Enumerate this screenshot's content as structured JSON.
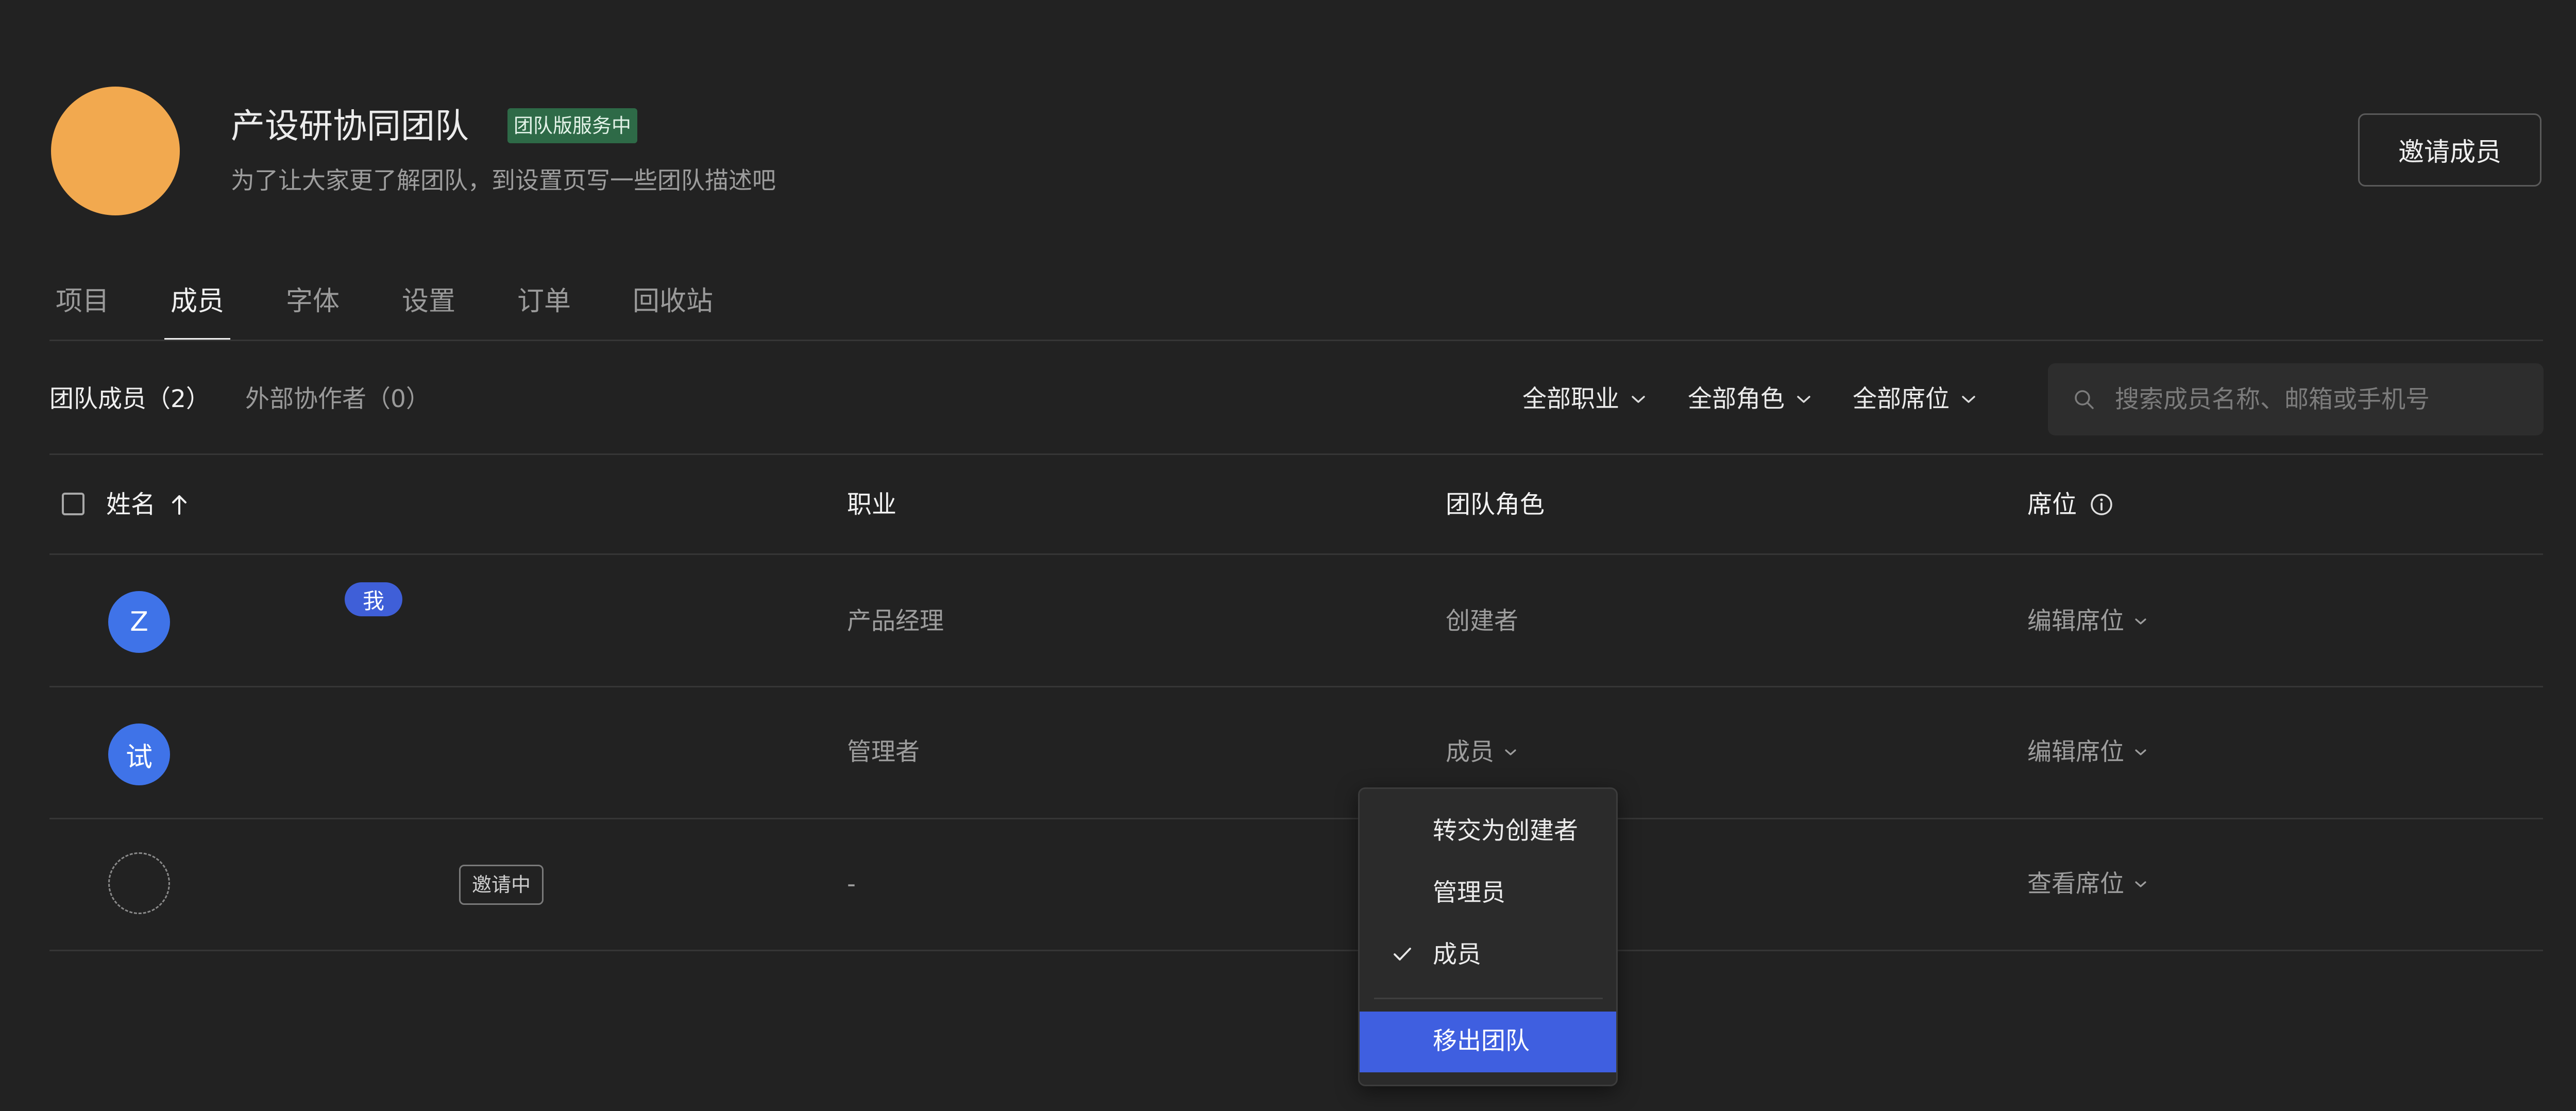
{
  "team": {
    "name": "产设研协同团队",
    "badge": "团队版服务中",
    "description": "为了让大家更了解团队，到设置页写一些团队描述吧",
    "avatar_color": "#f2a94f",
    "invite_button": "邀请成员"
  },
  "tabs": [
    {
      "label": "项目",
      "active": false
    },
    {
      "label": "成员",
      "active": true
    },
    {
      "label": "字体",
      "active": false
    },
    {
      "label": "设置",
      "active": false
    },
    {
      "label": "订单",
      "active": false
    },
    {
      "label": "回收站",
      "active": false
    }
  ],
  "member_tabs": {
    "team_members": "团队成员（2）",
    "external": "外部协作者（0）"
  },
  "filters": {
    "job": "全部职业",
    "role": "全部角色",
    "seat": "全部席位"
  },
  "search": {
    "placeholder": "搜索成员名称、邮箱或手机号",
    "value": ""
  },
  "table": {
    "headers": {
      "name": "姓名",
      "job": "职业",
      "role": "团队角色",
      "seat": "席位"
    },
    "sort": "ascending",
    "rows": [
      {
        "avatar": "Z",
        "badge": "我",
        "job": "产品经理",
        "role": "创建者",
        "role_editable": false,
        "seat": "编辑席位"
      },
      {
        "avatar": "试",
        "badge": "",
        "job": "管理者",
        "role": "成员",
        "role_editable": true,
        "seat": "编辑席位"
      },
      {
        "avatar": "",
        "badge": "邀请中",
        "job": "-",
        "role": "",
        "role_editable": false,
        "seat": "查看席位"
      }
    ]
  },
  "role_menu": {
    "items": [
      {
        "label": "转交为创建者",
        "checked": false
      },
      {
        "label": "管理员",
        "checked": false
      },
      {
        "label": "成员",
        "checked": true
      }
    ],
    "remove": "移出团队"
  },
  "colors": {
    "background": "#222222",
    "accent": "#3f5fe0",
    "avatar_blue": "#3f73e8",
    "badge_green": "#2e6a47"
  }
}
